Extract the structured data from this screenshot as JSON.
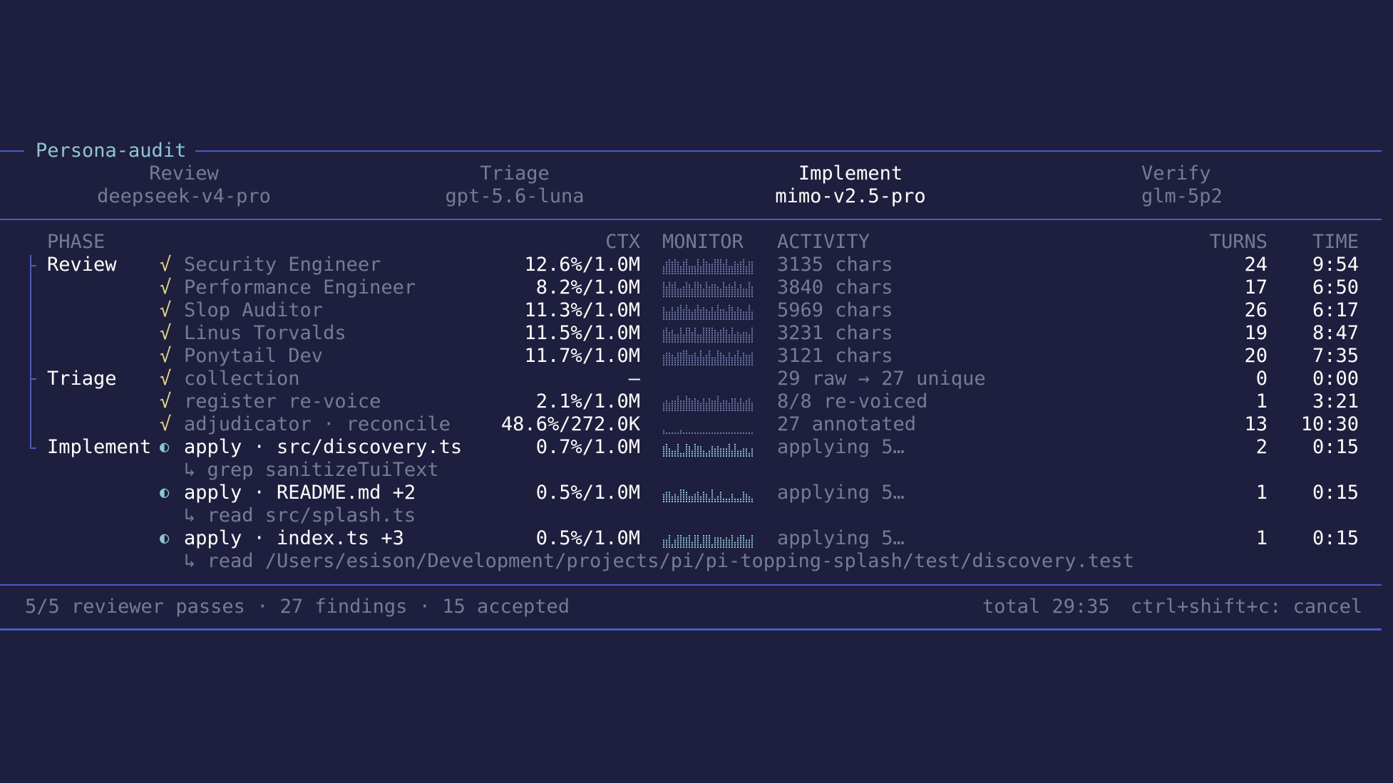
{
  "title": "Persona-audit",
  "stages": [
    {
      "name": "Review",
      "model": "deepseek-v4-pro",
      "active": false
    },
    {
      "name": "Triage",
      "model": "gpt-5.6-luna",
      "active": false
    },
    {
      "name": "Implement",
      "model": "mimo-v2.5-pro",
      "active": true
    },
    {
      "name": "Verify",
      "model": "glm-5p2",
      "active": false
    }
  ],
  "columns": {
    "phase": "PHASE",
    "ctx": "CTX",
    "monitor": "MONITOR",
    "activity": "ACTIVITY",
    "turns": "TURNS",
    "time": "TIME"
  },
  "phases": [
    "Review",
    "Triage",
    "Implement"
  ],
  "rows": [
    {
      "status": "√",
      "name": "Security Engineer",
      "ctx": "12.6%/1.0M",
      "activity": "3135 chars",
      "turns": "24",
      "time": "9:54"
    },
    {
      "status": "√",
      "name": "Performance Engineer",
      "ctx": "8.2%/1.0M",
      "activity": "3840 chars",
      "turns": "17",
      "time": "6:50"
    },
    {
      "status": "√",
      "name": "Slop Auditor",
      "ctx": "11.3%/1.0M",
      "activity": "5969 chars",
      "turns": "26",
      "time": "6:17"
    },
    {
      "status": "√",
      "name": "Linus Torvalds",
      "ctx": "11.5%/1.0M",
      "activity": "3231 chars",
      "turns": "19",
      "time": "8:47"
    },
    {
      "status": "√",
      "name": "Ponytail Dev",
      "ctx": "11.7%/1.0M",
      "activity": "3121 chars",
      "turns": "20",
      "time": "7:35"
    },
    {
      "status": "√",
      "name": "collection",
      "ctx": "—",
      "activity": "29 raw → 27 unique",
      "turns": "0",
      "time": "0:00"
    },
    {
      "status": "√",
      "name": "register re-voice",
      "ctx": "2.1%/1.0M",
      "activity": "8/8 re-voiced",
      "turns": "1",
      "time": "3:21"
    },
    {
      "status": "√",
      "name": "adjudicator · reconcile",
      "ctx": "48.6%/272.0K",
      "activity": "27 annotated",
      "turns": "13",
      "time": "10:30"
    },
    {
      "status": "◐",
      "name": "apply · src/discovery.ts",
      "ctx": "0.7%/1.0M",
      "activity": "applying 5…",
      "turns": "2",
      "time": "0:15",
      "sub": "↳ grep sanitizeTuiText"
    },
    {
      "status": "◐",
      "name": "apply · README.md +2",
      "ctx": "0.5%/1.0M",
      "activity": "applying 5…",
      "turns": "1",
      "time": "0:15",
      "sub": "↳ read src/splash.ts"
    },
    {
      "status": "◐",
      "name": "apply · index.ts +3",
      "ctx": "0.5%/1.0M",
      "activity": "applying 5…",
      "turns": "1",
      "time": "0:15",
      "sub": "↳ read /Users/esison/Development/projects/pi/pi-topping-splash/test/discovery.test"
    }
  ],
  "footer": {
    "summary": "5/5 reviewer passes · 27 findings · 15 accepted",
    "total": "total 29:35",
    "shortcut": "ctrl+shift+c: cancel"
  },
  "colors": {
    "background": "#1e1f3f",
    "border": "#4a5bc4",
    "accent": "#8cc6d0",
    "check": "#e6d77e",
    "dim": "#777b92"
  }
}
